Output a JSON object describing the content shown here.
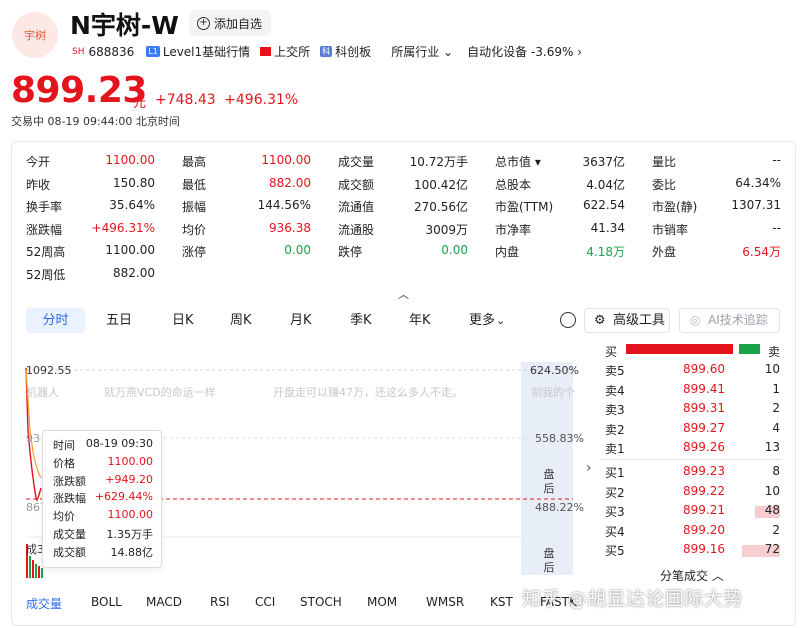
{
  "stock": {
    "logo_text": "宇树",
    "name": "N宇树-W",
    "add_watch_label": "添加自选",
    "market_code": "SH",
    "code": "688836",
    "level1_label": "Level1基础行情",
    "exchange": "上交所",
    "board": "科创板",
    "industry_label": "所属行业",
    "industry_value": "自动化设备 -3.69%",
    "price": "899.23",
    "price_unit": "元",
    "change": "+748.43",
    "change_pct": "+496.31%",
    "status": "交易中  08-19 09:44:00 北京时间"
  },
  "quote": {
    "rows": [
      [
        {
          "l": "今开",
          "v": "1100.00",
          "c": "red"
        },
        {
          "l": "最高",
          "v": "1100.00",
          "c": "red"
        },
        {
          "l": "成交量",
          "v": "10.72万手",
          "c": ""
        },
        {
          "l": "总市值 ▾",
          "v": "3637亿",
          "c": ""
        },
        {
          "l": "量比",
          "v": "--",
          "c": ""
        }
      ],
      [
        {
          "l": "昨收",
          "v": "150.80",
          "c": ""
        },
        {
          "l": "最低",
          "v": "882.00",
          "c": "red"
        },
        {
          "l": "成交额",
          "v": "100.42亿",
          "c": ""
        },
        {
          "l": "总股本",
          "v": "4.04亿",
          "c": ""
        },
        {
          "l": "委比",
          "v": "64.34%",
          "c": ""
        }
      ],
      [
        {
          "l": "换手率",
          "v": "35.64%",
          "c": ""
        },
        {
          "l": "振幅",
          "v": "144.56%",
          "c": ""
        },
        {
          "l": "流通值",
          "v": "270.56亿",
          "c": ""
        },
        {
          "l": "市盈(TTM)",
          "v": "622.54",
          "c": ""
        },
        {
          "l": "市盈(静)",
          "v": "1307.31",
          "c": ""
        }
      ],
      [
        {
          "l": "涨跌幅",
          "v": "+496.31%",
          "c": "red"
        },
        {
          "l": "均价",
          "v": "936.38",
          "c": "red"
        },
        {
          "l": "流通股",
          "v": "3009万",
          "c": ""
        },
        {
          "l": "市净率",
          "v": "41.34",
          "c": ""
        },
        {
          "l": "市销率",
          "v": "--",
          "c": ""
        }
      ],
      [
        {
          "l": "52周高",
          "v": "1100.00",
          "c": ""
        },
        {
          "l": "涨停",
          "v": "0.00",
          "c": "green"
        },
        {
          "l": "跌停",
          "v": "0.00",
          "c": "green"
        },
        {
          "l": "内盘",
          "v": "4.18万",
          "c": "green"
        },
        {
          "l": "外盘",
          "v": "6.54万",
          "c": "red"
        }
      ],
      [
        {
          "l": "52周低",
          "v": "882.00",
          "c": ""
        }
      ]
    ]
  },
  "toolbar": {
    "tabs": [
      "分时",
      "五日",
      "日K",
      "周K",
      "月K",
      "季K",
      "年K",
      "更多"
    ],
    "tools_label": "高级工具",
    "ai_label": "AI技术追踪"
  },
  "chart": {
    "price_high_label": "1092.55",
    "pct_high_label": "624.50%",
    "pct_mid_label": "558.83%",
    "pct_low_label": "488.22%",
    "left_mid_label": "93",
    "left_low_label": "867",
    "vol_label": "成3",
    "after_hours_label": "盘后",
    "ticker": [
      "机器人",
      "就万燕VCD的命运一样",
      "开盘走可以赚47万，还这么多人不走。",
      "割我的个"
    ],
    "tooltip": {
      "rows": [
        {
          "k": "时间",
          "v": "08-19 09:30",
          "c": ""
        },
        {
          "k": "价格",
          "v": "1100.00",
          "c": "red"
        },
        {
          "k": "涨跌额",
          "v": "+949.20",
          "c": "red"
        },
        {
          "k": "涨跌幅",
          "v": "+629.44%",
          "c": "red"
        },
        {
          "k": "均价",
          "v": "1100.00",
          "c": "red"
        },
        {
          "k": "成交量",
          "v": "1.35万手",
          "c": ""
        },
        {
          "k": "成交额",
          "v": "14.88亿",
          "c": ""
        }
      ]
    }
  },
  "indicators": [
    "成交量",
    "BOLL",
    "MACD",
    "RSI",
    "CCI",
    "STOCH",
    "MOM",
    "WMSR",
    "KST",
    "FASTK"
  ],
  "orderbook": {
    "buy_label": "买",
    "sell_label": "卖",
    "buy_ratio": 0.82,
    "asks": [
      {
        "l": "卖5",
        "p": "899.60",
        "v": "10",
        "bar": 0
      },
      {
        "l": "卖4",
        "p": "899.41",
        "v": "1",
        "bar": 0
      },
      {
        "l": "卖3",
        "p": "899.31",
        "v": "2",
        "bar": 0
      },
      {
        "l": "卖2",
        "p": "899.27",
        "v": "4",
        "bar": 0
      },
      {
        "l": "卖1",
        "p": "899.26",
        "v": "13",
        "bar": 0
      }
    ],
    "bids": [
      {
        "l": "买1",
        "p": "899.23",
        "v": "8",
        "bar": 0
      },
      {
        "l": "买2",
        "p": "899.22",
        "v": "10",
        "bar": 0
      },
      {
        "l": "买3",
        "p": "899.21",
        "v": "48",
        "bar": 0.46
      },
      {
        "l": "买4",
        "p": "899.20",
        "v": "2",
        "bar": 0
      },
      {
        "l": "买5",
        "p": "899.16",
        "v": "72",
        "bar": 0.69
      }
    ],
    "trades_label": "分笔成交"
  },
  "watermark": "知乎 @胡显达论国际大势",
  "colors": {
    "up": "#e4141d",
    "down": "#1aa34a",
    "accent": "#2f6ae6"
  }
}
